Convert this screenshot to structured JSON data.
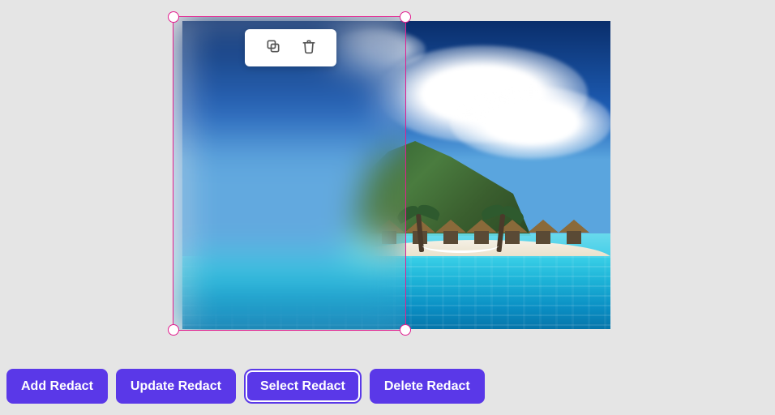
{
  "toolbar": {
    "buttons": {
      "add": "Add Redact",
      "update": "Update Redact",
      "select": "Select Redact",
      "delete": "Delete Redact"
    },
    "active": "select"
  },
  "floating": {
    "copy_icon": "copy-icon",
    "delete_icon": "trash-icon"
  },
  "redaction": {
    "selected": true,
    "effect": "blur",
    "handles": [
      "tl",
      "tr",
      "bl",
      "br"
    ]
  },
  "colors": {
    "primary": "#5a38e8",
    "selection": "#e11d8e"
  }
}
